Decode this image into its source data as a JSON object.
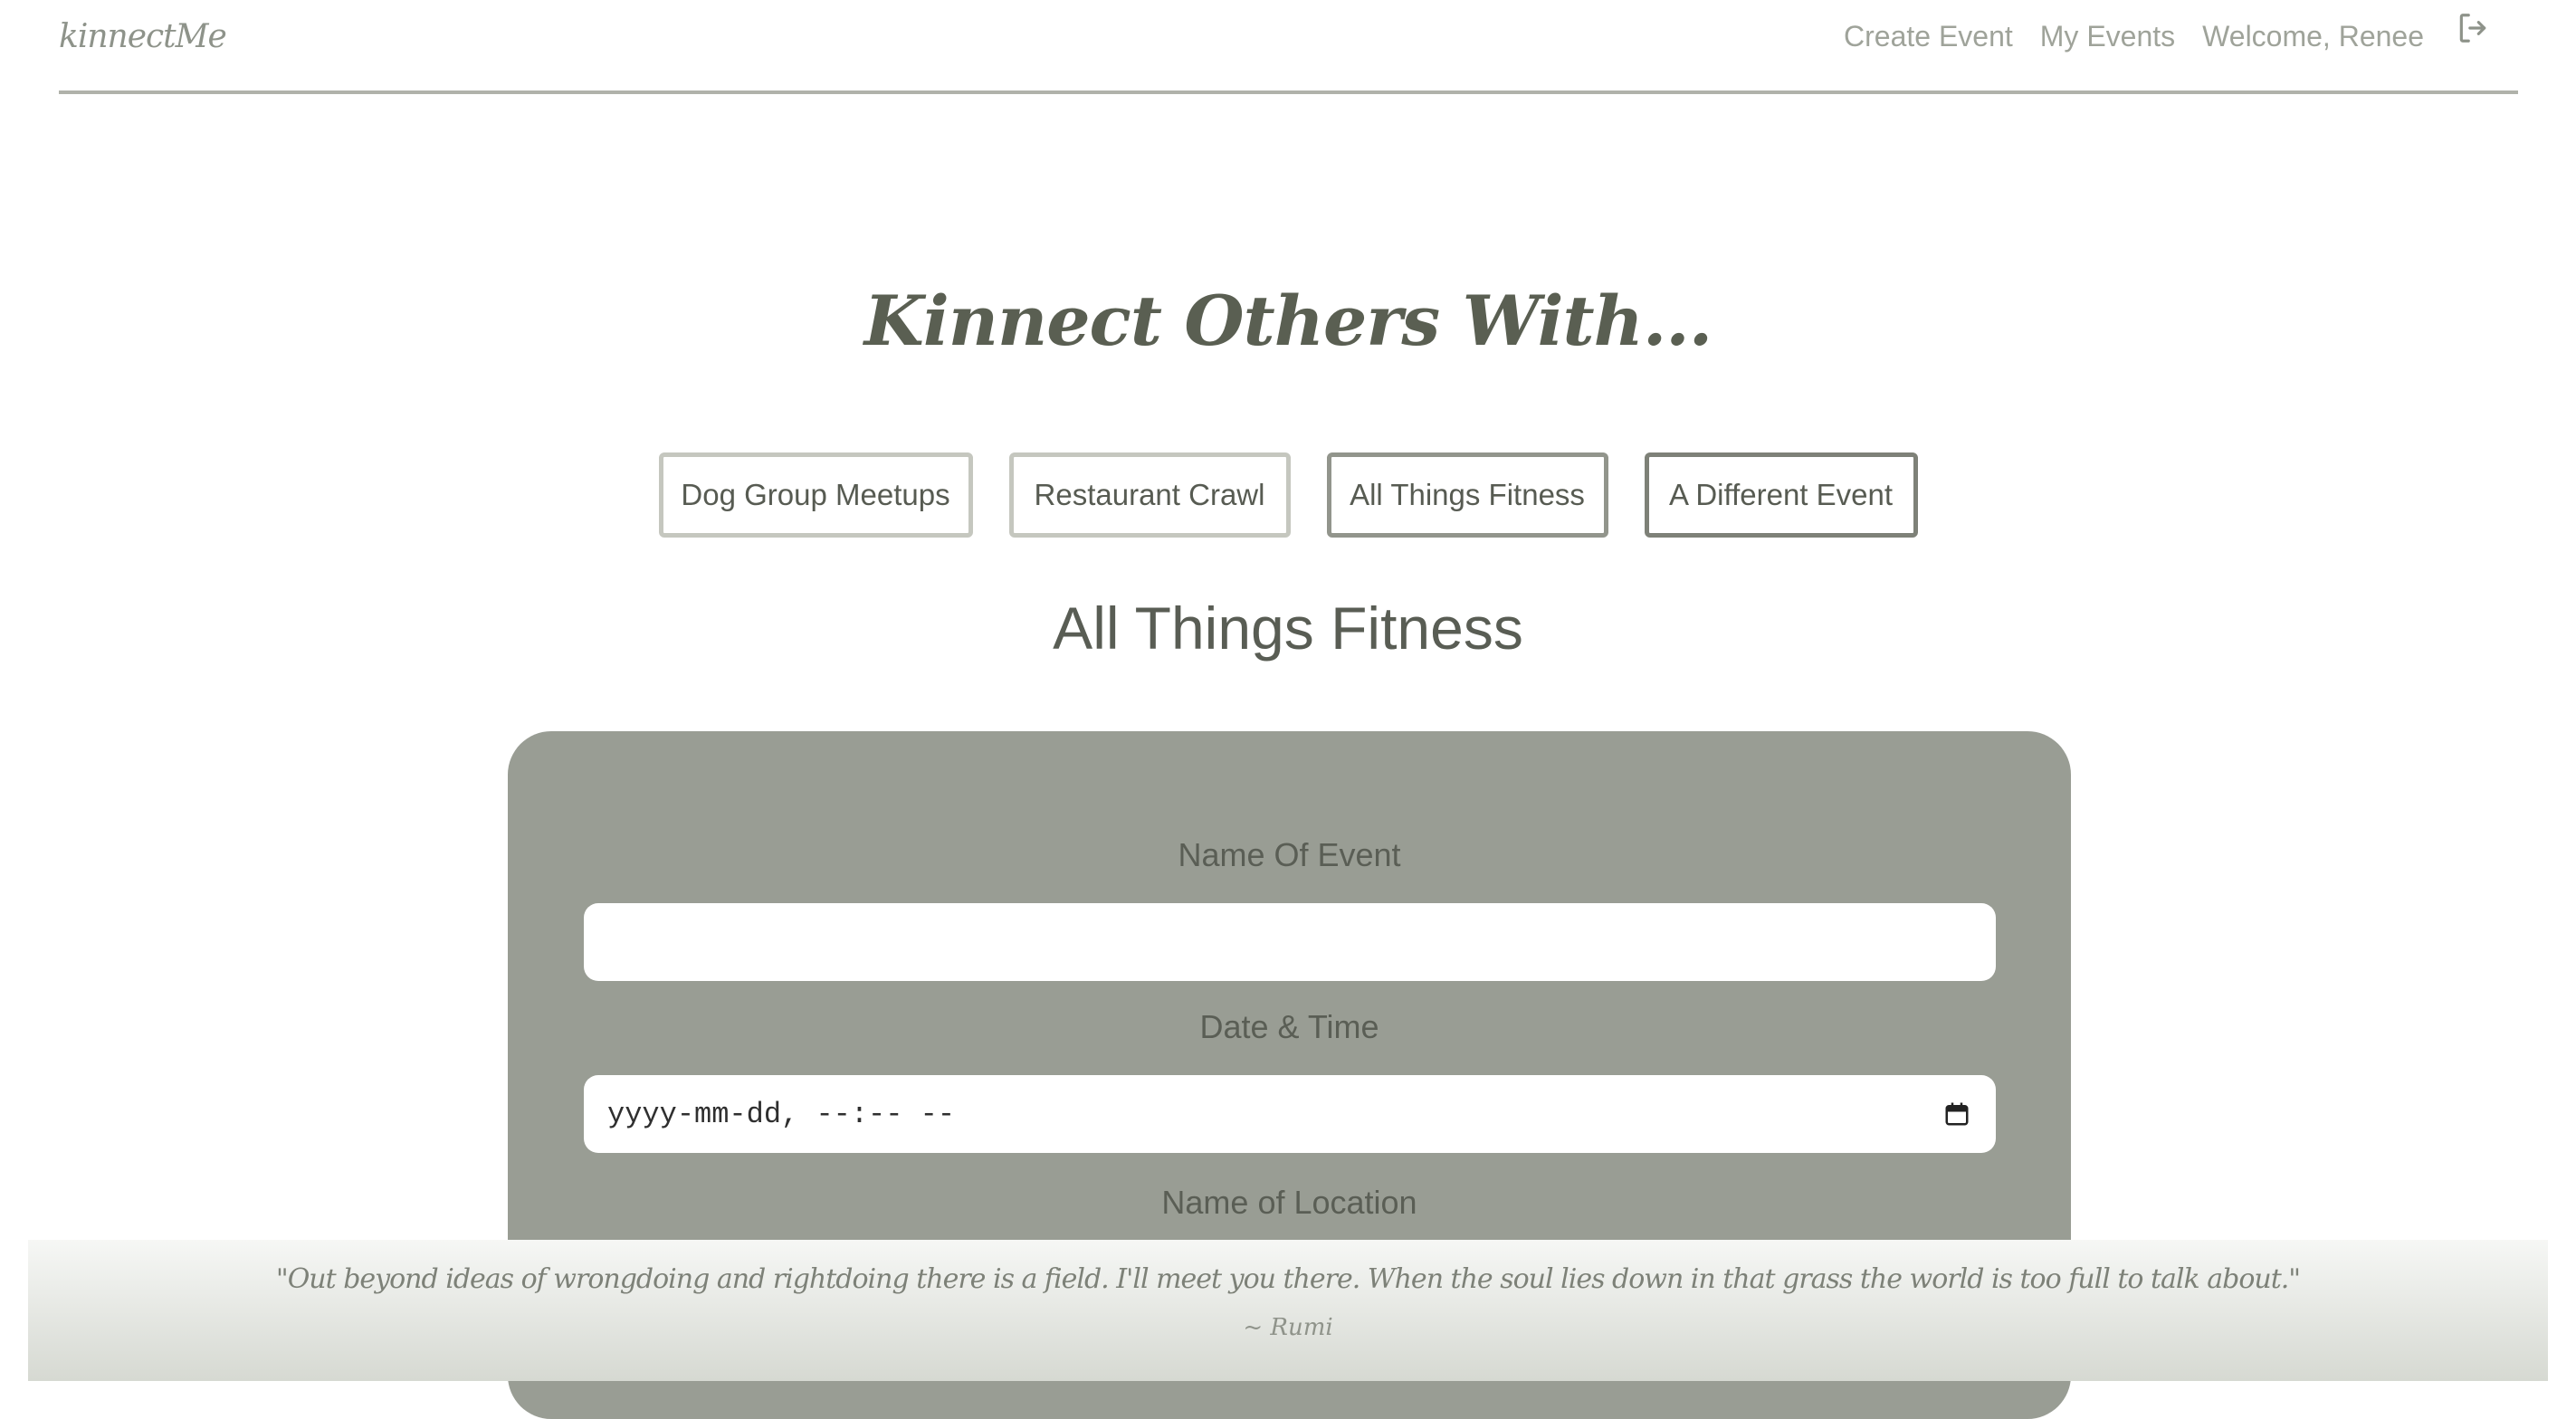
{
  "navbar": {
    "brand": "kinnectMe",
    "links": [
      "Create Event",
      "My Events",
      "Welcome, Renee"
    ],
    "logout_icon": "logout-icon"
  },
  "hero": {
    "title": "Kinnect Others With..."
  },
  "categories": [
    "Dog Group Meetups",
    "Restaurant Crawl",
    "All Things Fitness",
    "A Different Event"
  ],
  "section": {
    "title": "All Things Fitness"
  },
  "form": {
    "event_name_label": "Name Of Event",
    "event_name_value": "",
    "datetime_label": "Date & Time",
    "datetime_placeholder": "yyyy-mm-dd, --:-- --",
    "location_label": "Name of Location"
  },
  "footer": {
    "quote": "\"Out beyond ideas of wrongdoing and rightdoing there is a field. I'll meet you there. When the soul lies down in that grass the world is too full to talk about.\"",
    "author": "~ Rumi"
  },
  "colors": {
    "form_background": "#999d94",
    "text_dark": "#5a5e55",
    "nav_text": "#9fa39a"
  }
}
